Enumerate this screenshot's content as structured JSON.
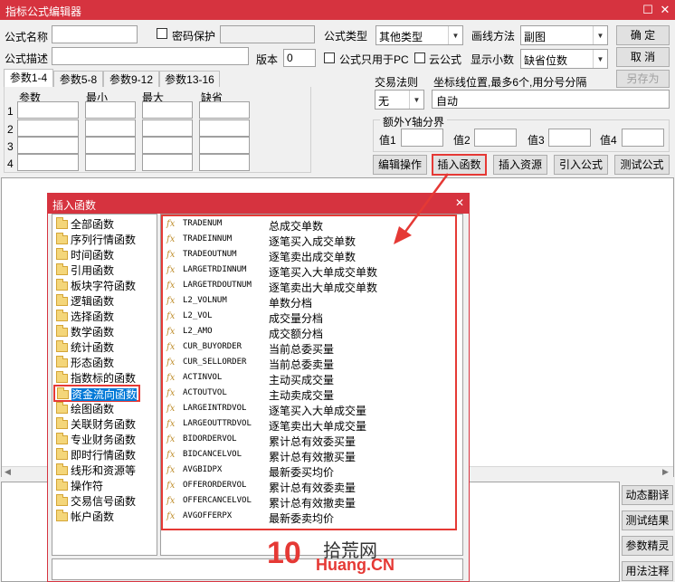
{
  "window": {
    "title": "指标公式编辑器",
    "restore_glyph": "☐",
    "close_glyph": "✕"
  },
  "form": {
    "name_label": "公式名称",
    "password_label": "密码保护",
    "type_label": "公式类型",
    "type_value": "其他类型",
    "draw_label": "画线方法",
    "draw_value": "副图",
    "desc_label": "公式描述",
    "version_label": "版本",
    "version_value": "0",
    "pc_only_label": "公式只用于PC",
    "cloud_label": "云公式",
    "decimals_label": "显示小数",
    "decimals_value": "缺省位数"
  },
  "buttons": {
    "ok": "确  定",
    "cancel": "取  消",
    "save_as": "另存为",
    "edit_ops": "编辑操作",
    "insert_func": "插入函数",
    "insert_res": "插入资源",
    "import_formula": "引入公式",
    "test_formula": "测试公式"
  },
  "tabs": [
    "参数1-4",
    "参数5-8",
    "参数9-12",
    "参数13-16"
  ],
  "param_headers": [
    "参数",
    "最小",
    "最大",
    "缺省"
  ],
  "param_rows": [
    "1",
    "2",
    "3",
    "4"
  ],
  "trade_rule_label": "交易法则",
  "trade_rule_value": "无",
  "axis_label": "坐标线位置,最多6个,用分号分隔",
  "axis_value": "自动",
  "extra_y_label": "额外Y轴分界",
  "extra_y_values": [
    "值1",
    "值2",
    "值3",
    "值4"
  ],
  "side_buttons": [
    "动态翻译",
    "测试结果",
    "参数精灵",
    "用法注释"
  ],
  "dialog": {
    "title": "插入函数",
    "close_glyph": "✕",
    "categories": [
      "全部函数",
      "序列行情函数",
      "时间函数",
      "引用函数",
      "板块字符函数",
      "逻辑函数",
      "选择函数",
      "数学函数",
      "统计函数",
      "形态函数",
      "指数标的函数",
      "资金流向函数",
      "绘图函数",
      "关联财务函数",
      "专业财务函数",
      "即时行情函数",
      "线形和资源等",
      "操作符",
      "交易信号函数",
      "帐户函数"
    ],
    "selected_category": "资金流向函数",
    "fx_glyph": "fx",
    "functions": [
      {
        "name": "TRADENUM",
        "desc": "总成交单数"
      },
      {
        "name": "TRADEINNUM",
        "desc": "逐笔买入成交单数"
      },
      {
        "name": "TRADEOUTNUM",
        "desc": "逐笔卖出成交单数"
      },
      {
        "name": "LARGETRDINNUM",
        "desc": "逐笔买入大单成交单数"
      },
      {
        "name": "LARGETRDOUTNUM",
        "desc": "逐笔卖出大单成交单数"
      },
      {
        "name": "L2_VOLNUM",
        "desc": "单数分档"
      },
      {
        "name": "L2_VOL",
        "desc": "成交量分档"
      },
      {
        "name": "L2_AMO",
        "desc": "成交额分档"
      },
      {
        "name": "CUR_BUYORDER",
        "desc": "当前总委买量"
      },
      {
        "name": "CUR_SELLORDER",
        "desc": "当前总委卖量"
      },
      {
        "name": "ACTINVOL",
        "desc": "主动买成交量"
      },
      {
        "name": "ACTOUTVOL",
        "desc": "主动卖成交量"
      },
      {
        "name": "LARGEINTRDVOL",
        "desc": "逐笔买入大单成交量"
      },
      {
        "name": "LARGEOUTTRDVOL",
        "desc": "逐笔卖出大单成交量"
      },
      {
        "name": "BIDORDERVOL",
        "desc": "累计总有效委买量"
      },
      {
        "name": "BIDCANCELVOL",
        "desc": "累计总有效撤买量"
      },
      {
        "name": "AVGBIDPX",
        "desc": "最新委买均价"
      },
      {
        "name": "OFFERORDERVOL",
        "desc": "累计总有效委卖量"
      },
      {
        "name": "OFFERCANCELVOL",
        "desc": "累计总有效撤卖量"
      },
      {
        "name": "AVGOFFERPX",
        "desc": "最新委卖均价"
      }
    ]
  },
  "watermark": {
    "logo": "10",
    "text": "拾荒网",
    "sub": "Huang.CN"
  },
  "colors": {
    "titlebar": "#d6333f",
    "highlight": "#e53935",
    "selection": "#0078d7"
  }
}
